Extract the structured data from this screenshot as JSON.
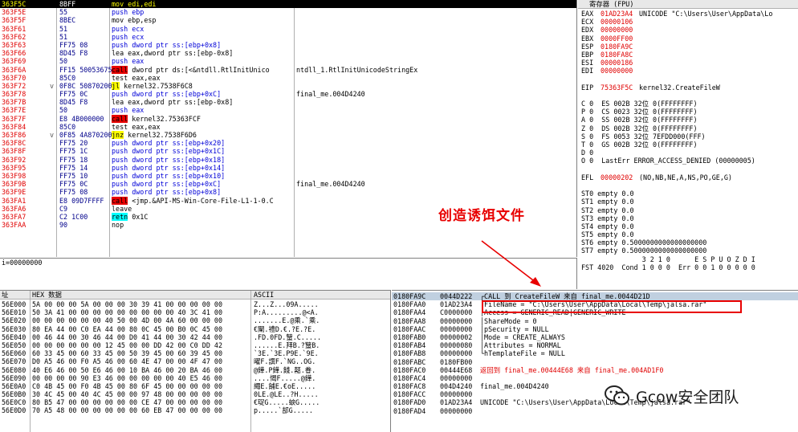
{
  "disasm": [
    {
      "addr": "363F5C",
      "hex": "8BFF",
      "instr": "mov edi,edi",
      "style": "normal",
      "comment": "",
      "selected": true
    },
    {
      "addr": "363F5E",
      "hex": "55",
      "instr": "push ebp",
      "style": "blue",
      "comment": ""
    },
    {
      "addr": "363F5F",
      "hex": "8BEC",
      "instr": "mov ebp,esp",
      "style": "normal",
      "comment": ""
    },
    {
      "addr": "363F61",
      "hex": "51",
      "instr": "push ecx",
      "style": "blue",
      "comment": ""
    },
    {
      "addr": "363F62",
      "hex": "51",
      "instr": "push ecx",
      "style": "blue",
      "comment": ""
    },
    {
      "addr": "363F63",
      "hex": "FF75 08",
      "instr": "push dword ptr ss:[ebp+0x8]",
      "style": "blue",
      "comment": ""
    },
    {
      "addr": "363F66",
      "hex": "8D45 F8",
      "instr": "lea eax,dword ptr ss:[ebp-0x8]",
      "style": "normal",
      "comment": ""
    },
    {
      "addr": "363F69",
      "hex": "50",
      "instr": "push eax",
      "style": "blue",
      "comment": ""
    },
    {
      "addr": "363F6A",
      "hex": "FF15 50053675",
      "instr": "call dword ptr ds:[<&ntdll.RtlInitUnico",
      "style": "call",
      "comment": "ntdll_1.RtlInitUnicodeStringEx"
    },
    {
      "addr": "363F70",
      "hex": "85C0",
      "instr": "test eax,eax",
      "style": "normal",
      "comment": ""
    },
    {
      "addr": "363F72",
      "hex": "0F8C 50870200",
      "instr": "jl kernel32.7538F6C8",
      "style": "jump",
      "comment": "",
      "mark": "v"
    },
    {
      "addr": "363F78",
      "hex": "FF75 0C",
      "instr": "push dword ptr ss:[ebp+0xC]",
      "style": "blue",
      "comment": "final_me.004D4240"
    },
    {
      "addr": "363F7B",
      "hex": "8D45 F8",
      "instr": "lea eax,dword ptr ss:[ebp-0x8]",
      "style": "normal",
      "comment": ""
    },
    {
      "addr": "363F7E",
      "hex": "50",
      "instr": "push eax",
      "style": "blue",
      "comment": ""
    },
    {
      "addr": "363F7F",
      "hex": "E8 4B000000",
      "instr": "call kernel32.75363FCF",
      "style": "call",
      "comment": ""
    },
    {
      "addr": "363F84",
      "hex": "85C0",
      "instr": "test eax,eax",
      "style": "normal",
      "comment": ""
    },
    {
      "addr": "363F86",
      "hex": "0F85 4A870200",
      "instr": "jnz kernel32.7538F6D6",
      "style": "jump",
      "comment": "",
      "mark": "v"
    },
    {
      "addr": "363F8C",
      "hex": "FF75 20",
      "instr": "push dword ptr ss:[ebp+0x20]",
      "style": "blue",
      "comment": ""
    },
    {
      "addr": "363F8F",
      "hex": "FF75 1C",
      "instr": "push dword ptr ss:[ebp+0x1C]",
      "style": "blue",
      "comment": ""
    },
    {
      "addr": "363F92",
      "hex": "FF75 18",
      "instr": "push dword ptr ss:[ebp+0x18]",
      "style": "blue",
      "comment": ""
    },
    {
      "addr": "363F95",
      "hex": "FF75 14",
      "instr": "push dword ptr ss:[ebp+0x14]",
      "style": "blue",
      "comment": ""
    },
    {
      "addr": "363F98",
      "hex": "FF75 10",
      "instr": "push dword ptr ss:[ebp+0x10]",
      "style": "blue",
      "comment": ""
    },
    {
      "addr": "363F9B",
      "hex": "FF75 0C",
      "instr": "push dword ptr ss:[ebp+0xC]",
      "style": "blue",
      "comment": "final_me.004D4240"
    },
    {
      "addr": "363F9E",
      "hex": "FF75 08",
      "instr": "push dword ptr ss:[ebp+0x8]",
      "style": "blue",
      "comment": ""
    },
    {
      "addr": "363FA1",
      "hex": "E8 09D7FFFF",
      "instr": "call <jmp.&API-MS-Win-Core-File-L1-1-0.C",
      "style": "call",
      "comment": ""
    },
    {
      "addr": "363FA6",
      "hex": "C9",
      "instr": "leave",
      "style": "normal",
      "comment": ""
    },
    {
      "addr": "363FA7",
      "hex": "C2 1C00",
      "instr": "retn 0x1C",
      "style": "retn",
      "comment": ""
    },
    {
      "addr": "363FAA",
      "hex": "90",
      "instr": "nop",
      "style": "normal",
      "comment": ""
    }
  ],
  "info_line": "i=00000000",
  "registers": {
    "title": "寄存器 (FPU)",
    "gprs": [
      {
        "name": "EAX",
        "value": "01AD23A4",
        "note": "UNICODE \"C:\\Users\\User\\AppData\\Lo"
      },
      {
        "name": "ECX",
        "value": "00000106",
        "note": ""
      },
      {
        "name": "EDX",
        "value": "00000000",
        "note": ""
      },
      {
        "name": "EBX",
        "value": "0000FF00",
        "note": ""
      },
      {
        "name": "ESP",
        "value": "0180FA9C",
        "note": ""
      },
      {
        "name": "EBP",
        "value": "0180FA8C",
        "note": ""
      },
      {
        "name": "ESI",
        "value": "00000186",
        "note": ""
      },
      {
        "name": "EDI",
        "value": "00000000",
        "note": ""
      }
    ],
    "eip": {
      "name": "EIP",
      "value": "75363F5C",
      "note": "kernel32.CreateFileW"
    },
    "segments": [
      "C 0  ES 002B 32位 0(FFFFFFFF)",
      "P 0  CS 0023 32位 0(FFFFFFFF)",
      "A 0  SS 002B 32位 0(FFFFFFFF)",
      "Z 0  DS 002B 32位 0(FFFFFFFF)",
      "S 0  FS 0053 32位 7EFDD000(FFF)",
      "T 0  GS 002B 32位 0(FFFFFFFF)",
      "D 0",
      "O 0  LastErr ERROR_ACCESS_DENIED (00000005)"
    ],
    "efl": {
      "name": "EFL",
      "value": "00000202",
      "note": "(NO,NB,NE,A,NS,PO,GE,G)"
    },
    "fpu": [
      "ST0 empty 0.0",
      "ST1 empty 0.0",
      "ST2 empty 0.0",
      "ST3 empty 0.0",
      "ST4 empty 0.0",
      "ST5 empty 0.0",
      "ST6 empty 0.5000000000000000000",
      "ST7 empty 0.5000000000000000000"
    ],
    "fpu_header": "               3 2 1 0      E S P U O Z D I",
    "fst": "FST 4020  Cond 1 0 0 0  Err 0 0 1 0 0 0 0 0"
  },
  "annotation": {
    "text": "创造诱饵文件",
    "color": "#e80000"
  },
  "dump": {
    "header_addr": "址",
    "header_hex": "HEX 数据",
    "header_ascii": "ASCII",
    "rows": [
      {
        "addr": "56E000",
        "hex": "5A 00 00 00 5A 00 00 00 30 39 41 00 00 00 00 00",
        "ascii": "Z...Z...09A....."
      },
      {
        "addr": "56E010",
        "hex": "50 3A 41 00 00 00 00 00 00 00 00 00 40 3C 41 00",
        "ascii": "P:A.........@<A."
      },
      {
        "addr": "56E020",
        "hex": "00 00 00 00 00 00 40 50 00 4D 00 4A 60 00 00 00",
        "ascii": ".......E.@乘.`乘."
      },
      {
        "addr": "56E030",
        "hex": "80 EA 44 00 C0 EA 44 00 80 0C 45 00 B0 0C 45 00",
        "ascii": "€闡.禮D.€.?E.?E."
      },
      {
        "addr": "56E040",
        "hex": "00 46 44 00 30 46 44 00 D0 41 44 00 30 42 44 00",
        "ascii": ".FD.0FD.蠥.C....."
      },
      {
        "addr": "56E050",
        "hex": "00 00 00 00 00 00 12 45 00 00 DD 42 00 C0 DD 42",
        "ascii": "......E.拜B.?蠥B."
      },
      {
        "addr": "56E060",
        "hex": "60 33 45 00 60 33 45 00 50 39 45 00 60 39 45 00",
        "ascii": "`3E.`3E.P9E.`9E."
      },
      {
        "addr": "56E070",
        "hex": "D0 A5 46 00 F0 A5 46 00 60 4E 47 00 00 4F 47 00",
        "ascii": "曜F.譔F.`NG..OG."
      },
      {
        "addr": "56E080",
        "hex": "40 E6 46 00 50 E6 46 00 10 BA 46 00 20 BA 46 00",
        "ascii": "@鏵.P鏵.餞.嚭.眷."
      },
      {
        "addr": "56E090",
        "hex": "00 00 00 00 90 E3 46 00 00 00 00 00 40 E5 46 00",
        "ascii": "....愒F.....@鏵."
      },
      {
        "addr": "56E0A0",
        "hex": "C0 4B 45 00 F0 4B 45 00 80 6F 45 00 00 00 00 00",
        "ascii": "繩E.餔E.€oE....."
      },
      {
        "addr": "56E0B0",
        "hex": "30 4C 45 00 40 4C 45 00 00 97 48 00 00 00 00 00",
        "ascii": "0LE.@LE..?H....."
      },
      {
        "addr": "56E0C0",
        "hex": "80 B5 47 00 00 00 00 00 00 CE 47 00 00 00 00 00",
        "ascii": "€珿G.....蜧G....."
      },
      {
        "addr": "56E0D0",
        "hex": "70 A5 48 00 00 00 00 00 00 60 EB 47 00 00 00 00",
        "ascii": "p.....`郆G....."
      }
    ]
  },
  "stack": {
    "rows": [
      {
        "addr": "0180FA9C",
        "val": "0044D222",
        "comment": "┌CALL 到 CreateFileW 来自 final_me.0044D21D",
        "style": "call"
      },
      {
        "addr": "0180FAA0",
        "val": "01AD23A4",
        "comment": "│FileName = \"C:\\Users\\User\\AppData\\Local\\Temp\\jalsa.rar\"",
        "style": "boxed"
      },
      {
        "addr": "0180FAA4",
        "val": "C0000000",
        "comment": "│Access = GENERIC_READ|GENERIC_WRITE",
        "style": "normal"
      },
      {
        "addr": "0180FAA8",
        "val": "00000000",
        "comment": "│ShareMode = 0",
        "style": "normal"
      },
      {
        "addr": "0180FAAC",
        "val": "00000000",
        "comment": "│pSecurity = NULL",
        "style": "normal"
      },
      {
        "addr": "0180FAB0",
        "val": "00000002",
        "comment": "│Mode = CREATE_ALWAYS",
        "style": "normal"
      },
      {
        "addr": "0180FAB4",
        "val": "00000080",
        "comment": "│Attributes = NORMAL",
        "style": "normal"
      },
      {
        "addr": "0180FAB8",
        "val": "00000000",
        "comment": "└hTemplateFile = NULL",
        "style": "normal"
      },
      {
        "addr": "0180FABC",
        "val": "0180FB00",
        "comment": "",
        "style": "normal"
      },
      {
        "addr": "0180FAC0",
        "val": "00444E68",
        "comment": "返回到 final_me.00444E68 来自 final_me.004AD1F0",
        "style": "ret"
      },
      {
        "addr": "0180FAC4",
        "val": "00000000",
        "comment": "",
        "style": "normal"
      },
      {
        "addr": "0180FAC8",
        "val": "004D4240",
        "comment": "final_me.004D4240",
        "style": "normal"
      },
      {
        "addr": "0180FACC",
        "val": "00000000",
        "comment": "",
        "style": "normal"
      },
      {
        "addr": "0180FAD0",
        "val": "01AD23A4",
        "comment": "UNICODE \"C:\\Users\\User\\AppData\\Local\\Temp\\jalsa.rar\"",
        "style": "normal"
      },
      {
        "addr": "0180FAD4",
        "val": "00000000",
        "comment": "",
        "style": "normal"
      }
    ]
  },
  "watermark": {
    "text": "Gcow安全团队",
    "icon": "wechat-icon"
  }
}
